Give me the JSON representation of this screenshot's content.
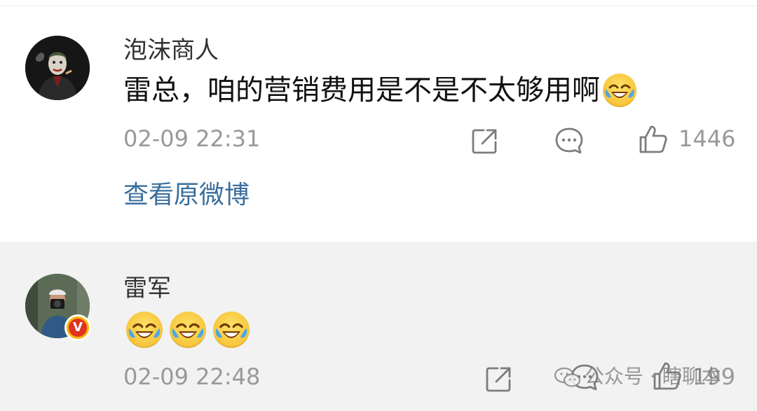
{
  "comment": {
    "username": "泡沫商人",
    "content": "雷总，咱的营销费用是不是不太够用啊",
    "emoji": "laugh-cry-emoji",
    "timestamp": "02-09 22:31",
    "like_count": "1446",
    "view_original_label": "查看原微博"
  },
  "reply": {
    "username": "雷军",
    "emojis": [
      "laugh-cry-emoji",
      "laugh-cry-emoji",
      "laugh-cry-emoji"
    ],
    "verified_badge": "V",
    "timestamp": "02-09 22:48",
    "like_count": "199"
  },
  "watermark": {
    "text": "公众号 · 瞎聊本"
  },
  "colors": {
    "link": "#3a6e9c",
    "meta_text": "#999999",
    "reply_background": "#f2f2f2",
    "badge_red": "#e0331f",
    "badge_gold": "#f7b500"
  }
}
